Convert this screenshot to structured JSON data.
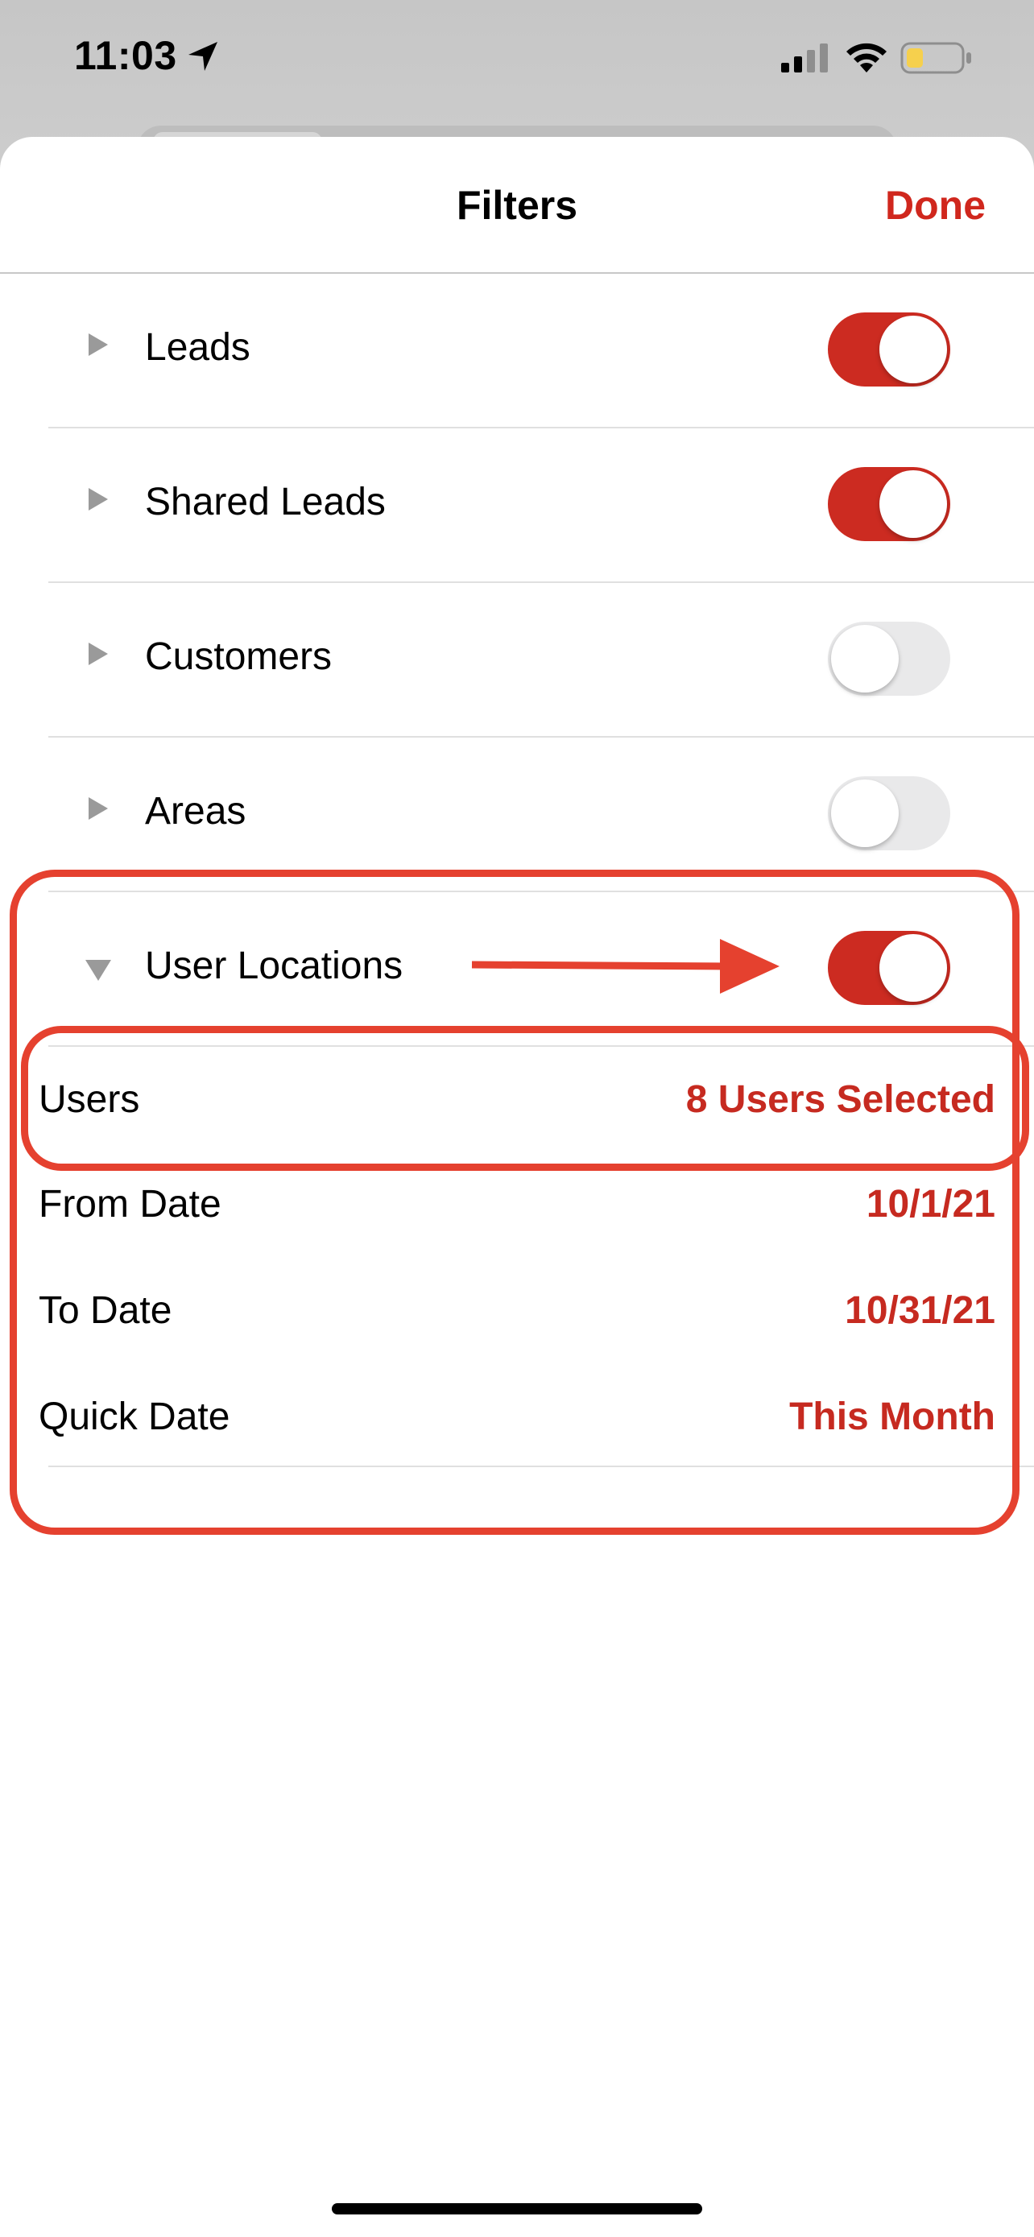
{
  "status_bar": {
    "time": "11:03",
    "icons": [
      "location-arrow-icon",
      "cellular-signal-icon",
      "wifi-icon",
      "battery-low-icon"
    ]
  },
  "nav": {
    "title": "Filters",
    "done_label": "Done"
  },
  "filters": [
    {
      "label": "Leads",
      "enabled": true,
      "expanded": false
    },
    {
      "label": "Shared Leads",
      "enabled": true,
      "expanded": false
    },
    {
      "label": "Customers",
      "enabled": false,
      "expanded": false
    },
    {
      "label": "Areas",
      "enabled": false,
      "expanded": false
    },
    {
      "label": "User Locations",
      "enabled": true,
      "expanded": true
    }
  ],
  "user_locations": {
    "users": {
      "label": "Users",
      "value": "8 Users Selected"
    },
    "from_date": {
      "label": "From Date",
      "value": "10/1/21"
    },
    "to_date": {
      "label": "To Date",
      "value": "10/31/21"
    },
    "quick_date": {
      "label": "Quick Date",
      "value": "This Month"
    }
  },
  "colors": {
    "accent": "#cc2b21",
    "annotation": "#e5412f",
    "toggle_off": "#e9e9ea"
  }
}
